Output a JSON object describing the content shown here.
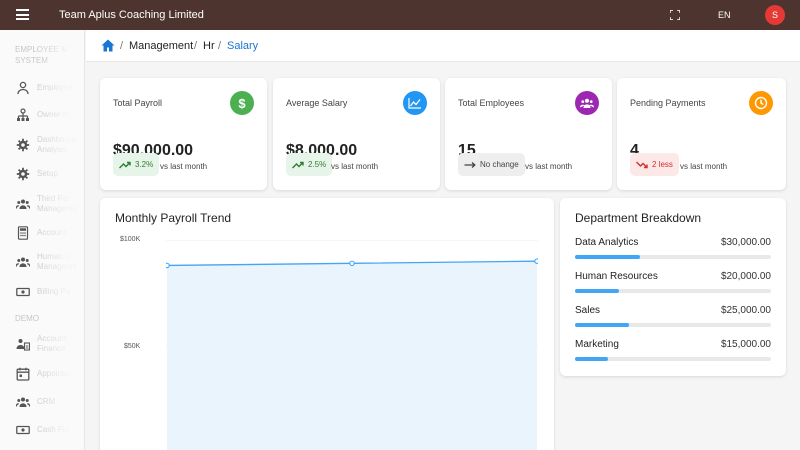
{
  "header": {
    "title": "Team Aplus Coaching Limited",
    "language": "EN",
    "avatar_initial": "S"
  },
  "sidebar": {
    "section1": "EMPLOYEE M SYSTEM",
    "section2": "DEMO",
    "items": [
      {
        "label": "Employee",
        "icon": "person-icon"
      },
      {
        "label": "Owner In",
        "icon": "org-chart-icon"
      },
      {
        "label": "Dashboard Analysis",
        "icon": "gear-icon"
      },
      {
        "label": "Setup",
        "icon": "gear-icon"
      },
      {
        "label": "Third Par Manageme",
        "icon": "group-icon"
      },
      {
        "label": "Accounti",
        "icon": "calculator-icon"
      },
      {
        "label": "Human C Manageme",
        "icon": "group-icon"
      },
      {
        "label": "Billing Pa",
        "icon": "money-icon"
      },
      {
        "label": "Accounti Finance",
        "icon": "finance-icon"
      },
      {
        "label": "Appointm",
        "icon": "calendar-icon"
      },
      {
        "label": "CRM",
        "icon": "group-icon"
      },
      {
        "label": "Cash Flo",
        "icon": "money-icon"
      }
    ]
  },
  "breadcrumb": {
    "items": [
      "Management",
      "Hr",
      "Salary"
    ],
    "separator": "/"
  },
  "stats": [
    {
      "label": "Total Payroll",
      "value": "$90,000.00",
      "change": "3.2%",
      "trend": "up",
      "note": "vs last month",
      "icon": "dollar-icon",
      "color": "#4caf50"
    },
    {
      "label": "Average Salary",
      "value": "$8,000.00",
      "change": "2.5%",
      "trend": "up",
      "note": "vs last month",
      "icon": "trend-chart-icon",
      "color": "#2196f3"
    },
    {
      "label": "Total Employees",
      "value": "15",
      "change": "No change",
      "trend": "flat",
      "note": "vs last month",
      "icon": "people-icon",
      "color": "#9c27b0"
    },
    {
      "label": "Pending Payments",
      "value": "4",
      "change": "2 less",
      "trend": "down",
      "note": "vs last month",
      "icon": "clock-icon",
      "color": "#ff9800"
    }
  ],
  "chart_data": {
    "type": "area",
    "title": "Monthly Payroll Trend",
    "x": [
      "",
      "",
      ""
    ],
    "series": [
      {
        "values": [
          88000,
          89000,
          90000
        ]
      }
    ],
    "ylim": [
      0,
      100000
    ],
    "yticks": [
      {
        "value": 100000,
        "label": "$100K"
      },
      {
        "value": 50000,
        "label": "$50K"
      }
    ],
    "grid": true,
    "color": "#42a5f5"
  },
  "department": {
    "title": "Department Breakdown",
    "items": [
      {
        "name": "Data Analytics",
        "amount": "$30,000.00",
        "share": 0.333
      },
      {
        "name": "Human Resources",
        "amount": "$20,000.00",
        "share": 0.222
      },
      {
        "name": "Sales",
        "amount": "$25,000.00",
        "share": 0.278
      },
      {
        "name": "Marketing",
        "amount": "$15,000.00",
        "share": 0.167
      }
    ]
  }
}
